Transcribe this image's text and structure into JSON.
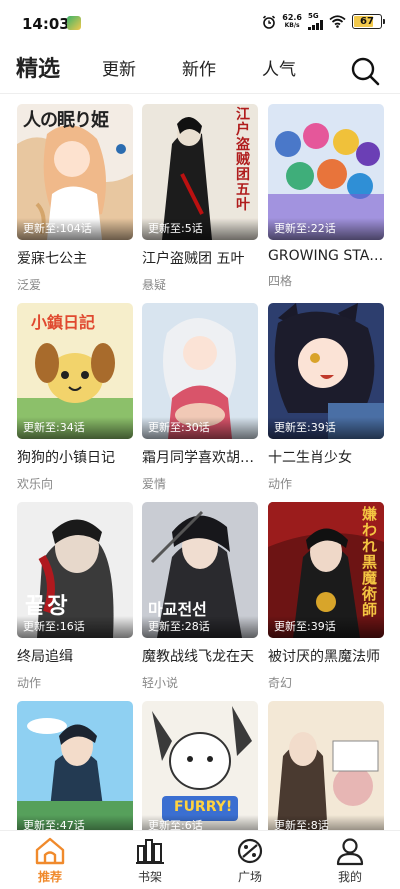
{
  "status_bar": {
    "time": "14:03",
    "net_speed_value": "62.6",
    "net_speed_unit": "KB/s",
    "network_type": "5G",
    "battery": "67",
    "battery_level": 0.67
  },
  "header": {
    "tabs": [
      {
        "label": "精选",
        "active": true
      },
      {
        "label": "更新",
        "active": false
      },
      {
        "label": "新作",
        "active": false
      },
      {
        "label": "人气",
        "active": false
      }
    ],
    "search_icon": "search-icon"
  },
  "comics": [
    {
      "title": "爱寐七公主",
      "genre": "泛爱",
      "update": "更新至:104话",
      "cover_text": "人の眠り姫"
    },
    {
      "title": "江户盗贼团 五叶",
      "genre": "悬疑",
      "update": "更新至:5话",
      "cover_text": "江户盗贼团 五叶"
    },
    {
      "title": "GROWING STARS",
      "genre": "四格",
      "update": "更新至:22话",
      "cover_text": ""
    },
    {
      "title": "狗狗的小镇日记",
      "genre": "欢乐向",
      "update": "更新至:34话",
      "cover_text": "小鎮日記"
    },
    {
      "title": "霜月同学喜欢胡思乱想",
      "genre": "爱情",
      "update": "更新至:30话",
      "cover_text": ""
    },
    {
      "title": "十二生肖少女",
      "genre": "动作",
      "update": "更新至:39话",
      "cover_text": ""
    },
    {
      "title": "终局追缉",
      "genre": "动作",
      "update": "更新至:16话",
      "cover_text": "끝장"
    },
    {
      "title": "魔教战线飞龙在天",
      "genre": "轻小说",
      "update": "更新至:28话",
      "cover_text": "마교전선"
    },
    {
      "title": "被讨厌的黑魔法师",
      "genre": "奇幻",
      "update": "更新至:39话",
      "cover_text": "嫌われ黒魔術師"
    },
    {
      "title": "",
      "genre": "",
      "update": "更新至:47话",
      "cover_text": ""
    },
    {
      "title": "",
      "genre": "",
      "update": "更新至:6话",
      "cover_text": "FURRY!"
    },
    {
      "title": "",
      "genre": "",
      "update": "更新至:8话",
      "cover_text": ""
    }
  ],
  "bottom_nav": [
    {
      "label": "推荐",
      "icon": "home-icon",
      "active": true
    },
    {
      "label": "书架",
      "icon": "bookshelf-icon",
      "active": false
    },
    {
      "label": "广场",
      "icon": "plaza-icon",
      "active": false
    },
    {
      "label": "我的",
      "icon": "profile-icon",
      "active": false
    }
  ],
  "colors": {
    "accent": "#f08a2c",
    "text": "#222222",
    "sub_text": "#888888"
  }
}
